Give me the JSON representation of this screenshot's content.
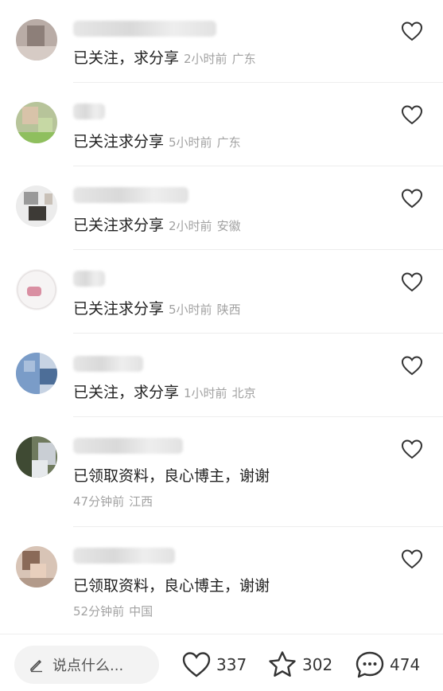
{
  "comments": [
    {
      "text": "已关注，求分享",
      "time": "2小时前",
      "location": "广东"
    },
    {
      "text": "已关注求分享",
      "time": "5小时前",
      "location": "广东"
    },
    {
      "text": "已关注求分享",
      "time": "2小时前",
      "location": "安徽"
    },
    {
      "text": "已关注求分享",
      "time": "5小时前",
      "location": "陕西"
    },
    {
      "text": "已关注，求分享",
      "time": "1小时前",
      "location": "北京"
    },
    {
      "text": "已领取资料，良心博主，谢谢",
      "time": "47分钟前",
      "location": "江西"
    },
    {
      "text": "已领取资料，良心博主，谢谢",
      "time": "52分钟前",
      "location": "中国"
    }
  ],
  "bottom_bar": {
    "input_placeholder": "说点什么...",
    "likes": "337",
    "favorites": "302",
    "comments": "474"
  },
  "icons": {
    "like": "heart-icon",
    "favorite": "star-icon",
    "comment": "chat-bubble-icon",
    "edit": "pencil-icon"
  }
}
